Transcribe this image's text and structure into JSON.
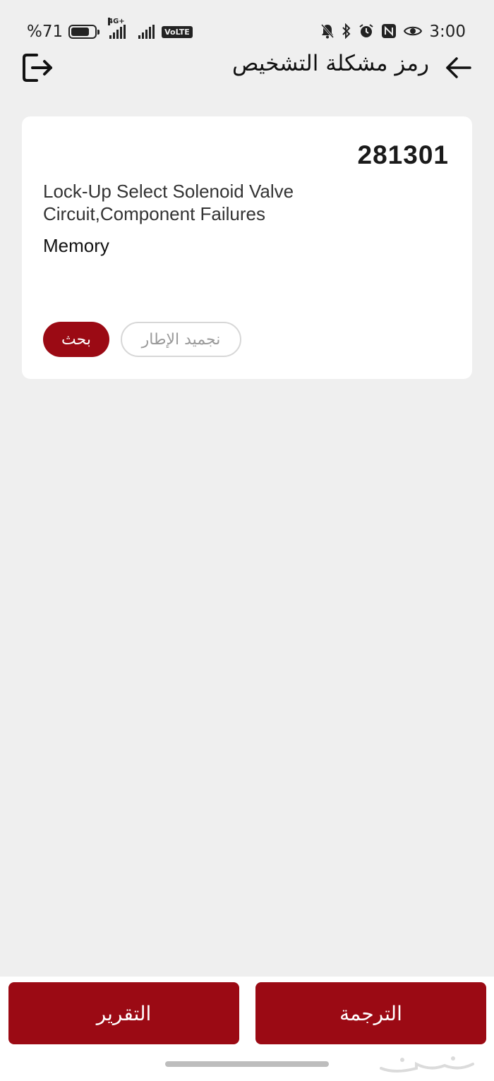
{
  "status_bar": {
    "battery_text": "%71",
    "network_tag": "4G+",
    "volte": "VoLTE",
    "time": "3:00"
  },
  "header": {
    "title": "رمز مشكلة التشخيص"
  },
  "dtc_card": {
    "code": "281301",
    "description": "Lock-Up Select Solenoid Valve Circuit,Component Failures",
    "status": "Memory",
    "search_label": "بحث",
    "freeze_frame_label": "نجميد الإطار"
  },
  "bottom_bar": {
    "report_label": "التقرير",
    "translate_label": "الترجمة"
  },
  "colors": {
    "accent": "#9b0a14",
    "background": "#efefef",
    "card": "#ffffff"
  }
}
